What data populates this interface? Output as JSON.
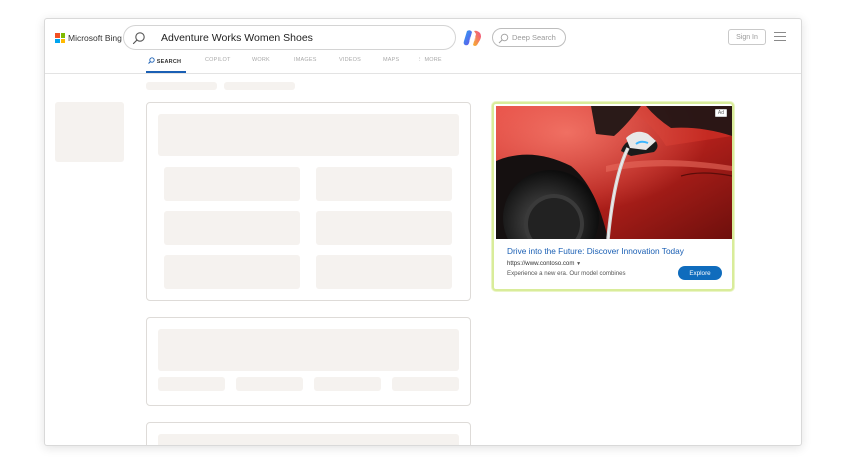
{
  "header": {
    "logo_text": "Microsoft Bing",
    "search_query": "Adventure Works Women Shoes",
    "deep_search_label": "Deep Search",
    "sign_in_label": "Sign In"
  },
  "tabs": [
    {
      "label": "SEARCH",
      "active": true
    },
    {
      "label": "COPILOT",
      "active": false
    },
    {
      "label": "WORK",
      "active": false
    },
    {
      "label": "IMAGES",
      "active": false
    },
    {
      "label": "VIDEOS",
      "active": false
    },
    {
      "label": "MAPS",
      "active": false
    },
    {
      "label": "MORE",
      "active": false
    }
  ],
  "ad": {
    "badge": "Ad",
    "title": "Drive into the Future: Discover Innovation Today",
    "url": "https://www.contoso.com",
    "description": "Experience a new era. Our model combines",
    "button_label": "Explore"
  },
  "colors": {
    "link_blue": "#1a5fb4",
    "button_blue": "#0f6cbd",
    "ad_border": "#d9ec9a",
    "placeholder": "#f5f2ef"
  }
}
